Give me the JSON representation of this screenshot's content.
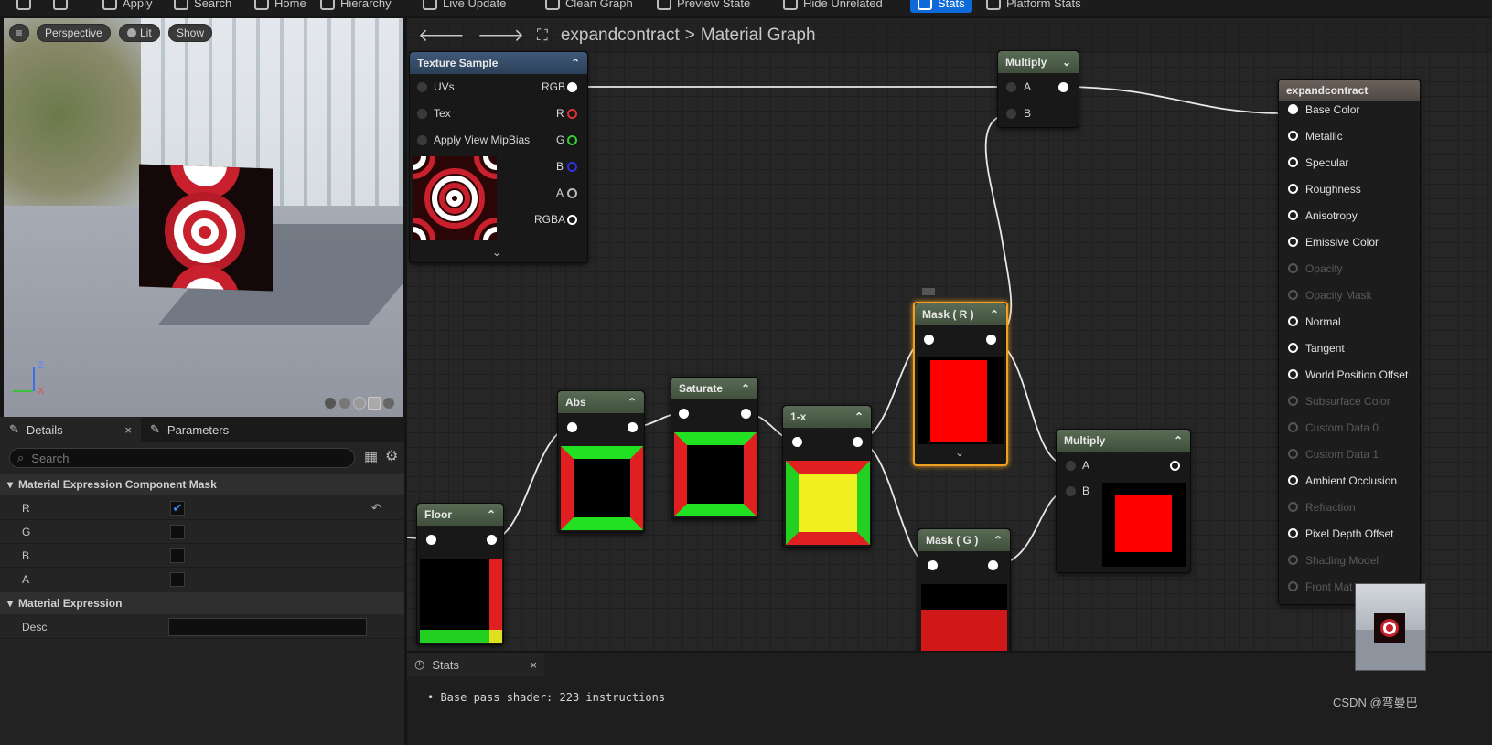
{
  "toolbar": {
    "items": [
      "Apply",
      "Search",
      "Home",
      "Hierarchy",
      "Live Update",
      "Clean Graph",
      "Preview State",
      "Hide Unrelated",
      "Stats",
      "Platform Stats"
    ]
  },
  "viewport": {
    "perspective": "Perspective",
    "lit": "Lit",
    "show": "Show",
    "axis_z": "Z",
    "axis_x": "X"
  },
  "details": {
    "tab_details": "Details",
    "tab_parameters": "Parameters",
    "search_placeholder": "Search",
    "cat1": "Material Expression Component Mask",
    "channels": [
      {
        "label": "R",
        "checked": true
      },
      {
        "label": "G",
        "checked": false
      },
      {
        "label": "B",
        "checked": false
      },
      {
        "label": "A",
        "checked": false
      }
    ],
    "cat2": "Material Expression",
    "desc_label": "Desc",
    "desc_value": ""
  },
  "graph": {
    "breadcrumb_root": "expandcontract",
    "breadcrumb_sep": ">",
    "breadcrumb_current": "Material Graph",
    "texture_sample": {
      "title": "Texture Sample",
      "inputs": [
        "UVs",
        "Tex",
        "Apply View MipBias"
      ],
      "outputs": [
        "RGB",
        "R",
        "G",
        "B",
        "A",
        "RGBA"
      ]
    },
    "multiply_top": {
      "title": "Multiply",
      "a": "A",
      "b": "B"
    },
    "multiply_bottom": {
      "title": "Multiply",
      "a": "A",
      "b": "B"
    },
    "abs": {
      "title": "Abs"
    },
    "saturate": {
      "title": "Saturate"
    },
    "one_minus": {
      "title": "1-x"
    },
    "floor": {
      "title": "Floor"
    },
    "mask_r": {
      "title": "Mask ( R )"
    },
    "mask_g": {
      "title": "Mask ( G )"
    },
    "result": {
      "title": "expandcontract",
      "pins": [
        {
          "label": "Base Color",
          "enabled": true
        },
        {
          "label": "Metallic",
          "enabled": true
        },
        {
          "label": "Specular",
          "enabled": true
        },
        {
          "label": "Roughness",
          "enabled": true
        },
        {
          "label": "Anisotropy",
          "enabled": true
        },
        {
          "label": "Emissive Color",
          "enabled": true
        },
        {
          "label": "Opacity",
          "enabled": false
        },
        {
          "label": "Opacity Mask",
          "enabled": false
        },
        {
          "label": "Normal",
          "enabled": true
        },
        {
          "label": "Tangent",
          "enabled": true
        },
        {
          "label": "World Position Offset",
          "enabled": true
        },
        {
          "label": "Subsurface Color",
          "enabled": false
        },
        {
          "label": "Custom Data 0",
          "enabled": false
        },
        {
          "label": "Custom Data 1",
          "enabled": false
        },
        {
          "label": "Ambient Occlusion",
          "enabled": true
        },
        {
          "label": "Refraction",
          "enabled": false
        },
        {
          "label": "Pixel Depth Offset",
          "enabled": true
        },
        {
          "label": "Shading Model",
          "enabled": false
        },
        {
          "label": "Front Mat",
          "enabled": false
        }
      ]
    }
  },
  "stats": {
    "tab": "Stats",
    "line1": "Base pass shader: 223 instructions"
  },
  "watermark": "CSDN @弯曼巴"
}
